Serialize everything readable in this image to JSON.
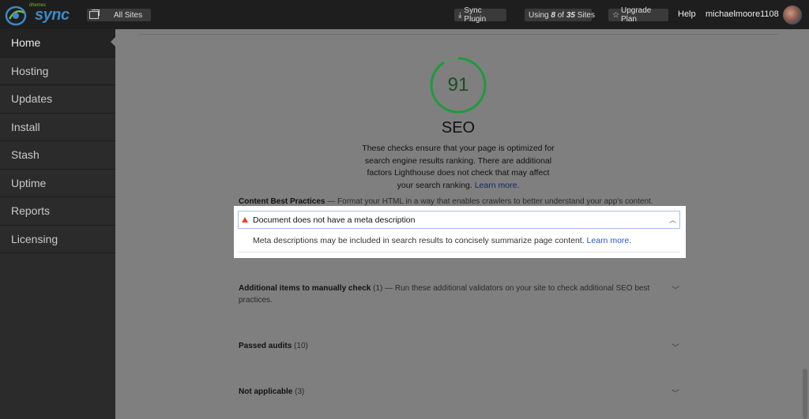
{
  "topbar": {
    "logo_small": "ithemes",
    "logo_big": "sync",
    "sites_label": "All Sites",
    "sync_plugin": "Sync Plugin",
    "usage_prefix": "Using",
    "usage_used": "8",
    "usage_of": "of",
    "usage_total": "35",
    "usage_suffix": "Sites",
    "upgrade": "Upgrade Plan",
    "help": "Help",
    "username": "michaelmoore1108"
  },
  "sidebar": {
    "items": [
      {
        "label": "Home"
      },
      {
        "label": "Hosting"
      },
      {
        "label": "Updates"
      },
      {
        "label": "Install"
      },
      {
        "label": "Stash"
      },
      {
        "label": "Uptime"
      },
      {
        "label": "Reports"
      },
      {
        "label": "Licensing"
      }
    ]
  },
  "report": {
    "score": "91",
    "score_fraction": 0.91,
    "score_color": "#1f9a3c",
    "title": "SEO",
    "description": "These checks ensure that your page is optimized for search engine results ranking. There are additional factors Lighthouse does not check that may affect your search ranking.",
    "learn_more": "Learn more",
    "content_best": {
      "title": "Content Best Practices",
      "dash": "—",
      "text": "Format your HTML in a way that enables crawlers to better understand your app's content."
    },
    "audit": {
      "title": "Document does not have a meta description",
      "body": "Meta descriptions may be included in search results to concisely summarize page content.",
      "learn_more": "Learn more",
      "icon": "warning-triangle-icon"
    },
    "manual": {
      "title": "Additional items to manually check",
      "count": "(1)",
      "dash": "—",
      "text": "Run these additional validators on your site to check additional SEO best practices."
    },
    "passed": {
      "title": "Passed audits",
      "count": "(10)"
    },
    "na": {
      "title": "Not applicable",
      "count": "(3)"
    }
  }
}
